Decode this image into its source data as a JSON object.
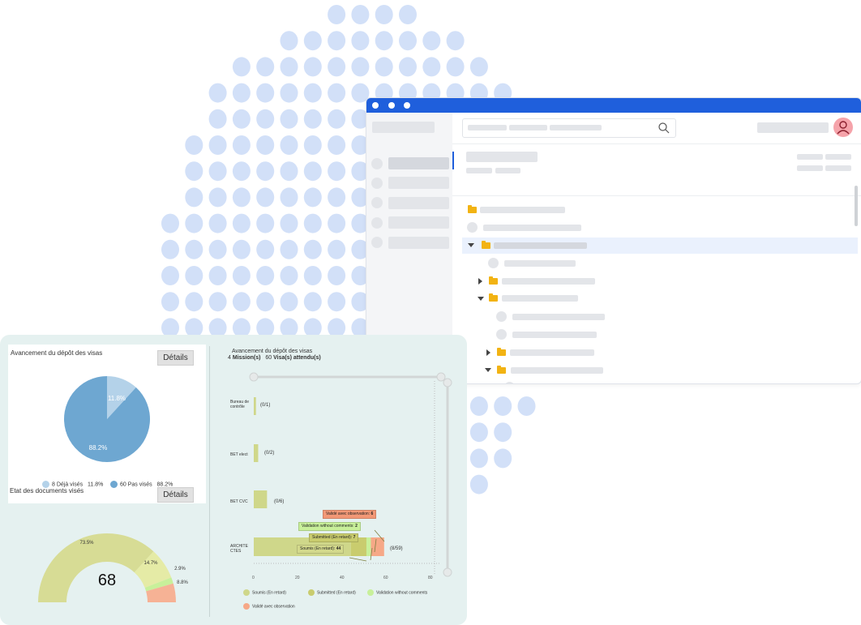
{
  "colors": {
    "accent": "#1f5fdc",
    "dots": "#d2e0f8",
    "folder": "#f2b313",
    "avatar": "#f5a3aa",
    "pie_light": "#b4d2e9",
    "pie_dark": "#6ea7d1",
    "soumis": "#cfd78a",
    "submitted": "#c9cc6e",
    "validation": "#c8f09a",
    "valide_obs": "#f6a887"
  },
  "dashboard": {
    "card1": {
      "title": "Avancement du dépôt des visas",
      "details_label": "Détails",
      "slices": [
        {
          "label": "Déjà visés",
          "count": 8,
          "percent": 11.8,
          "percent_label": "11.8%",
          "color": "#b4d2e9"
        },
        {
          "label": "Pas visés",
          "count": 60,
          "percent": 88.2,
          "percent_label": "88.2%",
          "color": "#6ea7d1"
        }
      ],
      "legend": [
        {
          "text": "8 Déjà visés",
          "pct": "11.8%"
        },
        {
          "text": "60 Pas visés",
          "pct": "88.2%"
        }
      ]
    },
    "card2": {
      "title": "Etat des documents visés",
      "details_label": "Détails",
      "center_value": "68",
      "slices": [
        {
          "percent": 73.5,
          "label": "73.5%",
          "color": "#d7dc95"
        },
        {
          "percent": 14.7,
          "label": "14.7%",
          "color": "#e5eba6"
        },
        {
          "percent": 2.9,
          "label": "2.9%",
          "color": "#c8f09a"
        },
        {
          "percent": 8.8,
          "label": "8.8%",
          "color": "#f6b295"
        }
      ]
    },
    "bar_chart": {
      "title": "Avancement du dépôt des visas",
      "missions_num": "4",
      "missions_label": "Mission(s)",
      "visas_num": "60",
      "visas_label": "Visa(s) attendu(s)",
      "rows": [
        {
          "label": "Bureau de contrôle",
          "value": 1,
          "note": "(0/1)"
        },
        {
          "label": "BET elect",
          "value": 2,
          "note": "(0/2)"
        },
        {
          "label": "BET CVC",
          "value": 6,
          "note": "(0/6)"
        },
        {
          "label": "ARCHITECTES",
          "value": 59,
          "note": "(8/59)"
        }
      ],
      "arch_segments": [
        {
          "name": "Soumis (En retard)",
          "value": 44
        },
        {
          "name": "Submitted (En retard)",
          "value": 7
        },
        {
          "name": "Validation without comments",
          "value": 2
        },
        {
          "name": "Validé avec observation",
          "value": 6
        }
      ],
      "tooltips": [
        {
          "text": "Validé avec observation:",
          "value": "6"
        },
        {
          "text": "Validation without comments:",
          "value": "2"
        },
        {
          "text": "Submitted (En retard):",
          "value": "7"
        },
        {
          "text": "Soumis (En retard):",
          "value": "44"
        }
      ],
      "ticks": [
        "0",
        "20",
        "40",
        "60",
        "80"
      ],
      "xlim": [
        0,
        80
      ],
      "legend": [
        "Soumis (En retard)",
        "Submitted (En retard)",
        "Validation without comments",
        "Validé avec observation"
      ]
    }
  }
}
